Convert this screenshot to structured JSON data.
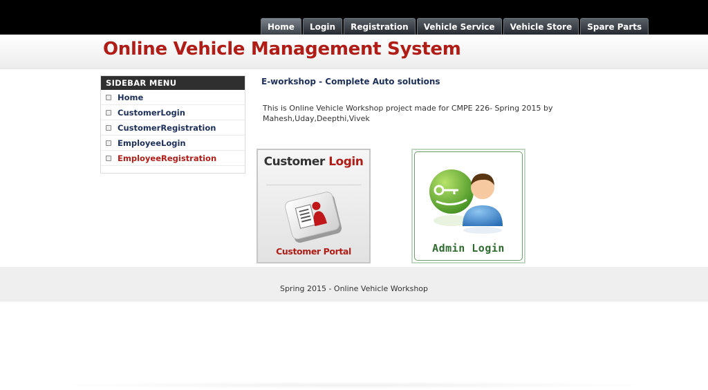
{
  "nav": {
    "items": [
      "Home",
      "Login",
      "Registration",
      "Vehicle Service",
      "Vehicle Store",
      "Spare Parts"
    ]
  },
  "header": {
    "title": "Online Vehicle Management System"
  },
  "sidebar": {
    "heading": "SIDEBAR MENU",
    "items": [
      {
        "label": "Home"
      },
      {
        "label": "CustomerLogin"
      },
      {
        "label": "CustomerRegistration"
      },
      {
        "label": "EmployeeLogin"
      },
      {
        "label": "EmployeeRegistration"
      }
    ]
  },
  "main": {
    "title": "E-workshop - Complete Auto solutions",
    "description": "This is Online Vehicle Workshop project made for CMPE 226- Spring 2015 by Mahesh,Uday,Deepthi,Vivek",
    "customer_card": {
      "title_part1": "Customer",
      "title_part2": "Login",
      "subtitle": "Customer Portal"
    },
    "admin_card": {
      "label": "Admin Login"
    }
  },
  "footer": {
    "text": "Spring 2015 - Online Vehicle Workshop"
  },
  "colors": {
    "brand_red": "#b01c16",
    "navy": "#1c2f59",
    "admin_green": "#2d6a2d"
  }
}
